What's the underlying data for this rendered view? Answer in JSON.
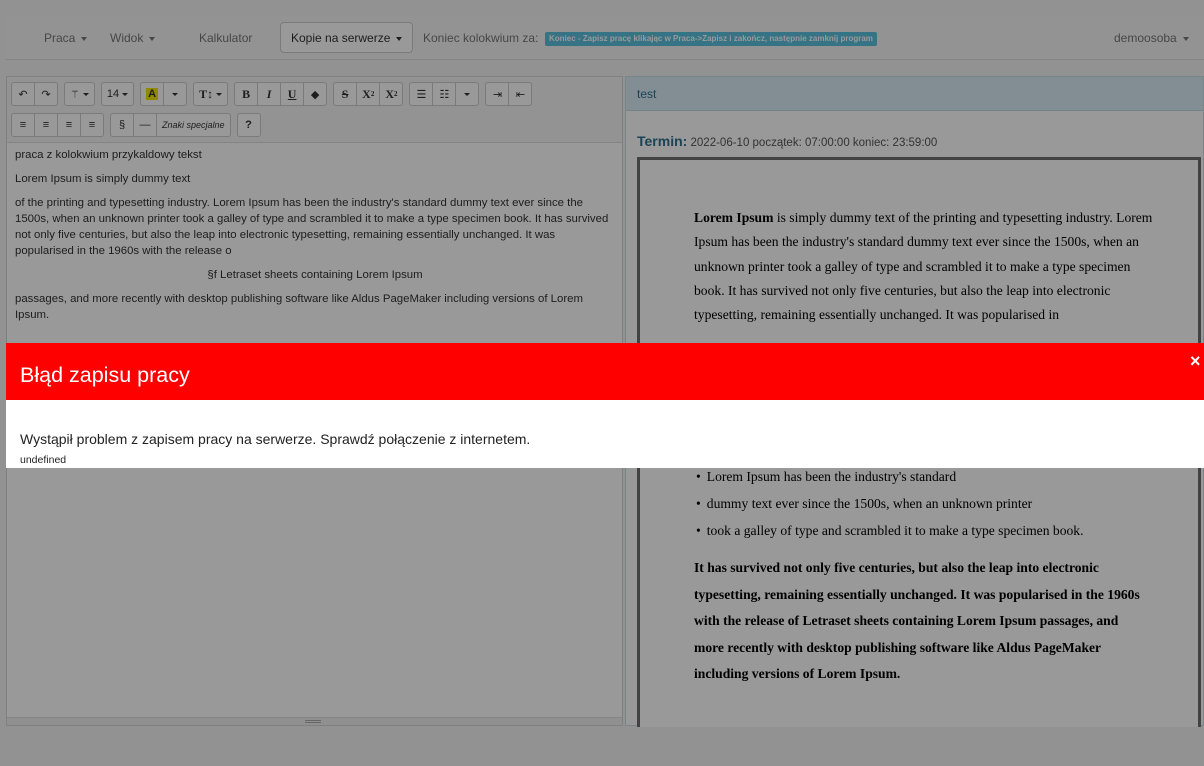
{
  "navbar": {
    "menu_praca": "Praca",
    "menu_widok": "Widok",
    "menu_kalkulator": "Kalkulator",
    "backup_button": "Kopie na serwerze",
    "countdown_label": "Koniec kolokwium za:",
    "countdown_badge": "Koniec - Zapisz pracę klikając w Praca->Zapisz i zakończ, następnie zamknij program",
    "user": "demoosoba"
  },
  "toolbar": {
    "font_size": "14",
    "text_color": "A",
    "style": "T↕",
    "bold": "B",
    "italic": "I",
    "underline": "U",
    "strike": "S",
    "sup": "X",
    "sub": "X",
    "paragraph": "§",
    "dash": "—",
    "special_chars": "Znaki specjalne",
    "help": "?"
  },
  "editor": {
    "paragraphs": [
      "praca z kolokwium przykaldowy tekst",
      "Lorem Ipsum is simply dummy text",
      "of the printing and typesetting industry. Lorem Ipsum has been the industry's standard dummy text ever since the 1500s, when an unknown printer took a galley of type and scrambled it to make a type specimen book. It has survived not only five centuries, but also the leap into electronic typesetting, remaining essentially unchanged. It was popularised in the 1960s with the release o",
      "§f Letraset sheets containing Lorem Ipsum",
      "passages, and more recently with desktop publishing software like Aldus PageMaker including versions of Lorem Ipsum."
    ]
  },
  "preview": {
    "header": "test",
    "term_label": "Termin:",
    "term_value": "2022-06-10 początek: 07:00:00 koniec: 23:59:00",
    "doc_bold_lead": "Lorem Ipsum",
    "doc_intro": " is simply dummy text of the printing and typesetting industry. Lorem Ipsum has been the industry's standard dummy text ever since the 1500s, when an unknown printer took a galley of type and scrambled it to make a type specimen book. It has survived not only five centuries, but also the leap into electronic typesetting, remaining essentially unchanged. It was popularised in",
    "doc_list": [
      "Lorem Ipsum has been the industry's standard",
      "dummy text ever since the 1500s, when an unknown printer",
      "took a galley of type and scrambled it to make a type specimen book."
    ],
    "doc_bold_para": "It has survived not only five centuries, but also the leap into electronic typesetting, remaining essentially unchanged. It was popularised in the 1960s with the release of Letraset sheets containing Lorem Ipsum passages, and more recently with desktop publishing software like Aldus PageMaker including versions of Lorem Ipsum."
  },
  "modal": {
    "title": "Błąd zapisu pracy",
    "close": "×",
    "message": "Wystąpił problem z zapisem pracy na serwerze. Sprawdź połączenie z internetem.",
    "detail": "undefined"
  },
  "colors": {
    "modal_header": "#ff0000",
    "badge": "#5bc0de",
    "preview_header": "#d9edf7"
  }
}
